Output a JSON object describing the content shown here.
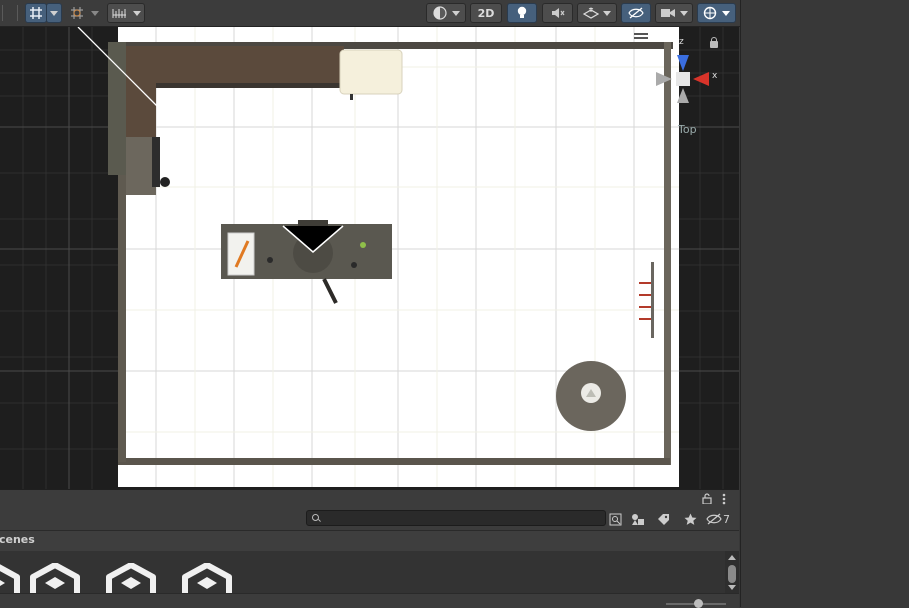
{
  "toolbar": {
    "btn_2d_label": "2D",
    "hidden_count_label": "7"
  },
  "viewport": {
    "gizmo_view_label": "Top",
    "axis_x_label": "x",
    "axis_z_label": "z"
  },
  "project_panel": {
    "search": {
      "placeholder": "",
      "value": ""
    },
    "hidden_count": "7",
    "breadcrumb": "cenes"
  },
  "colors": {
    "toolbar_bg": "#3c3c3c",
    "active_blue": "#46607c",
    "viewport_bg": "#1e1e1e",
    "floor": "#ffffff",
    "wall": "#5f5a50",
    "axis_x_red": "#d8342a",
    "axis_z_blue": "#3a6ee0"
  },
  "icons": [
    "snap-grid-icon",
    "grid-dropdown-icon",
    "increment-snap-icon",
    "ruler-icon",
    "shading-mode-icon",
    "lighting-icon",
    "audio-mute-icon",
    "effects-icon",
    "scene-visibility-icon",
    "camera-icon",
    "gizmos-icon",
    "lock-icon",
    "menu-kebab-icon",
    "search-icon",
    "save-search-icon",
    "filter-by-type-icon",
    "filter-by-label-icon",
    "favorite-star-icon",
    "hidden-packages-icon",
    "unity-scene-asset-icon"
  ]
}
